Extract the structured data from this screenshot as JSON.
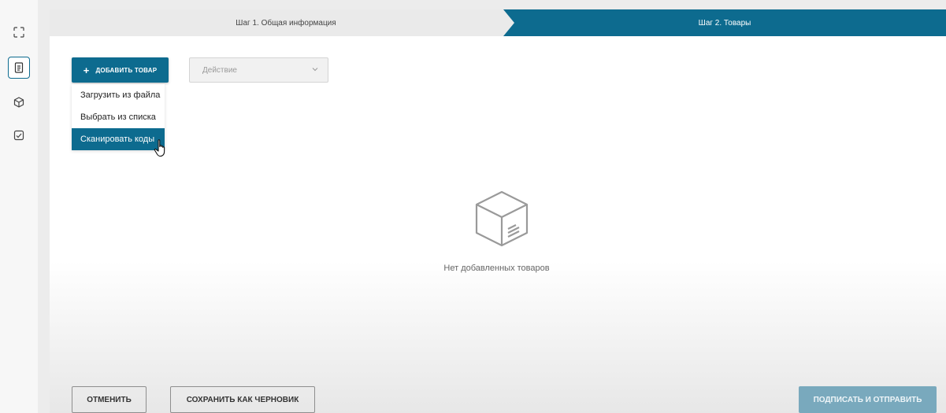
{
  "sidebar": {
    "items": [
      {
        "icon": "fullscreen-icon"
      },
      {
        "icon": "document-icon",
        "active": true
      },
      {
        "icon": "box-icon"
      },
      {
        "icon": "checklist-icon"
      }
    ]
  },
  "steps": {
    "step1_label": "Шаг 1. Общая информация",
    "step2_label": "Шаг 2. Товары",
    "active_color": "#0d6b8f"
  },
  "toolbar": {
    "add_button_plus": "+",
    "add_button_label": "ДОБАВИТЬ ТОВАР",
    "action_placeholder": "Действие"
  },
  "add_menu": {
    "items": [
      {
        "label": "Загрузить из файла"
      },
      {
        "label": "Выбрать из списка"
      },
      {
        "label": "Сканировать коды",
        "highlighted": true
      }
    ]
  },
  "empty_state": {
    "icon": "empty-box-icon",
    "text": "Нет добавленных товаров"
  },
  "footer": {
    "cancel_label": "ОТМЕНИТЬ",
    "draft_label": "СОХРАНИТЬ КАК ЧЕРНОВИК",
    "submit_label": "ПОДПИСАТЬ И ОТПРАВИТЬ",
    "submit_color": "#79a9bd"
  }
}
